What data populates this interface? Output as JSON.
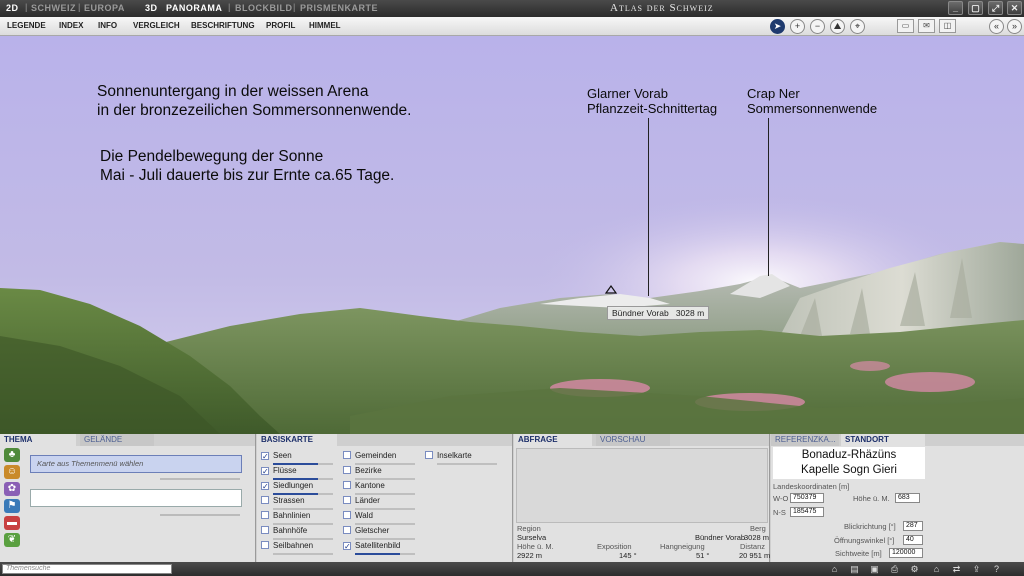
{
  "topbar": {
    "mode_2d": "2D",
    "mode_schweiz": "SCHWEIZ",
    "mode_europa": "EUROPA",
    "mode_3d": "3D",
    "mode_panorama": "PANORAMA",
    "mode_blockbild": "BLOCKBILD",
    "mode_prismenkarte": "PRISMENKARTE",
    "app_title": "Atlas der Schweiz"
  },
  "menu": {
    "legende": "LEGENDE",
    "index": "INDEX",
    "info": "INFO",
    "vergleich": "VERGLEICH",
    "beschriftung": "BESCHRIFTUNG",
    "profil": "PROFIL",
    "himmel": "HIMMEL"
  },
  "icons": {
    "cursor": "pointer-icon",
    "zoom_in": "zoom-in-icon",
    "zoom_out": "zoom-out-icon",
    "terrain": "terrain-icon",
    "position": "position-icon"
  },
  "viewport": {
    "annotation_line1": "Sonnenuntergang in der weissen Arena",
    "annotation_line2": "in der bronzezeilichen Sommersonnenwende.",
    "annotation_line3": "Die Pendelbewegung  der Sonne",
    "annotation_line4": "Mai - Juli dauerte bis zur Ernte ca.65 Tage.",
    "peak1_line1": "Glarner Vorab",
    "peak1_line2": "Pflanzzeit-Schnittertag",
    "peak2_line1": "Crap Ner",
    "peak2_line2": "Sommersonnenwende",
    "peak_tag_name": "Bündner Vorab",
    "peak_tag_height": "3028 m"
  },
  "thema_panel": {
    "tab_thema": "THEMA",
    "tab_gelaende": "GELÄNDE",
    "select_placeholder": "Karte aus Themenmenü wählen"
  },
  "basiskarte": {
    "tab": "BASISKARTE",
    "col1": [
      {
        "label": "Seen",
        "checked": true
      },
      {
        "label": "Flüsse",
        "checked": true
      },
      {
        "label": "Siedlungen",
        "checked": true
      },
      {
        "label": "Strassen",
        "checked": false
      },
      {
        "label": "Bahnlinien",
        "checked": false
      },
      {
        "label": "Bahnhöfe",
        "checked": false
      },
      {
        "label": "Seilbahnen",
        "checked": false
      }
    ],
    "col2": [
      {
        "label": "Gemeinden",
        "checked": false
      },
      {
        "label": "Bezirke",
        "checked": false
      },
      {
        "label": "Kantone",
        "checked": false
      },
      {
        "label": "Länder",
        "checked": false
      },
      {
        "label": "Wald",
        "checked": false
      },
      {
        "label": "Gletscher",
        "checked": false
      },
      {
        "label": "Satellitenbild",
        "checked": true
      }
    ],
    "col3": [
      {
        "label": "Inselkarte",
        "checked": false
      }
    ],
    "check_mark": "✓"
  },
  "abfrage": {
    "tab_abfrage": "ABFRAGE",
    "tab_vorschau": "VORSCHAU",
    "region_label": "Region",
    "region_value": "Surselva",
    "berg_label": "Berg",
    "berg_value": "Bündner Vorab",
    "berg_height": "3028 m",
    "hoehe_label": "Höhe ü. M.",
    "hoehe_value": "2922 m",
    "exposition_label": "Exposition",
    "exposition_value": "145 °",
    "hangneigung_label": "Hangneigung",
    "hangneigung_value": "51 °",
    "distanz_label": "Distanz",
    "distanz_value": "20 951 m"
  },
  "standort": {
    "tab_referenz": "REFERENZKA...",
    "tab_standort": "STANDORT",
    "place_line1": "Bonaduz-Rhäzüns",
    "place_line2": "Kapelle Sogn Gieri",
    "coords_label": "Landeskoordinaten [m]",
    "wo_label": "W-O",
    "wo_value": "750379",
    "ns_label": "N-S",
    "ns_value": "185475",
    "hoehe_label": "Höhe ü. M.",
    "hoehe_value": "683",
    "blickrichtung_label": "Blickrichtung [°]",
    "blickrichtung_value": "287",
    "oeffnungswinkel_label": "Öffnungswinkel [°]",
    "oeffnungswinkel_value": "40",
    "sichtweite_label": "Sichtweite [m]",
    "sichtweite_value": "120000"
  },
  "statusbar": {
    "search_placeholder": "Themensuche"
  }
}
